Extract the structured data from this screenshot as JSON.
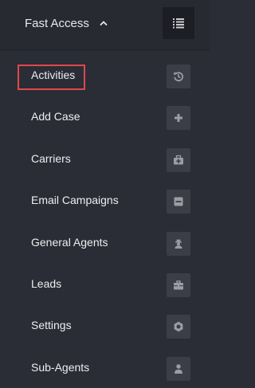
{
  "header": {
    "title": "Fast Access",
    "collapse_icon": "chevron-up-icon",
    "menu_icon": "list-icon"
  },
  "items": [
    {
      "label": "Activities",
      "icon": "history-icon",
      "selected": true
    },
    {
      "label": "Add Case",
      "icon": "plus-icon"
    },
    {
      "label": "Carriers",
      "icon": "medical-kit-icon"
    },
    {
      "label": "Email Campaigns",
      "icon": "inbox-icon"
    },
    {
      "label": "General Agents",
      "icon": "user-secret-icon"
    },
    {
      "label": "Leads",
      "icon": "briefcase-icon"
    },
    {
      "label": "Settings",
      "icon": "gear-icon"
    },
    {
      "label": "Sub-Agents",
      "icon": "user-icon"
    }
  ],
  "colors": {
    "panel_bg": "#2a2d35",
    "header_bg": "#272a31",
    "icon_box_bg": "#3b3e46",
    "icon_color": "#9a9da4",
    "highlight": "#e1474b"
  }
}
